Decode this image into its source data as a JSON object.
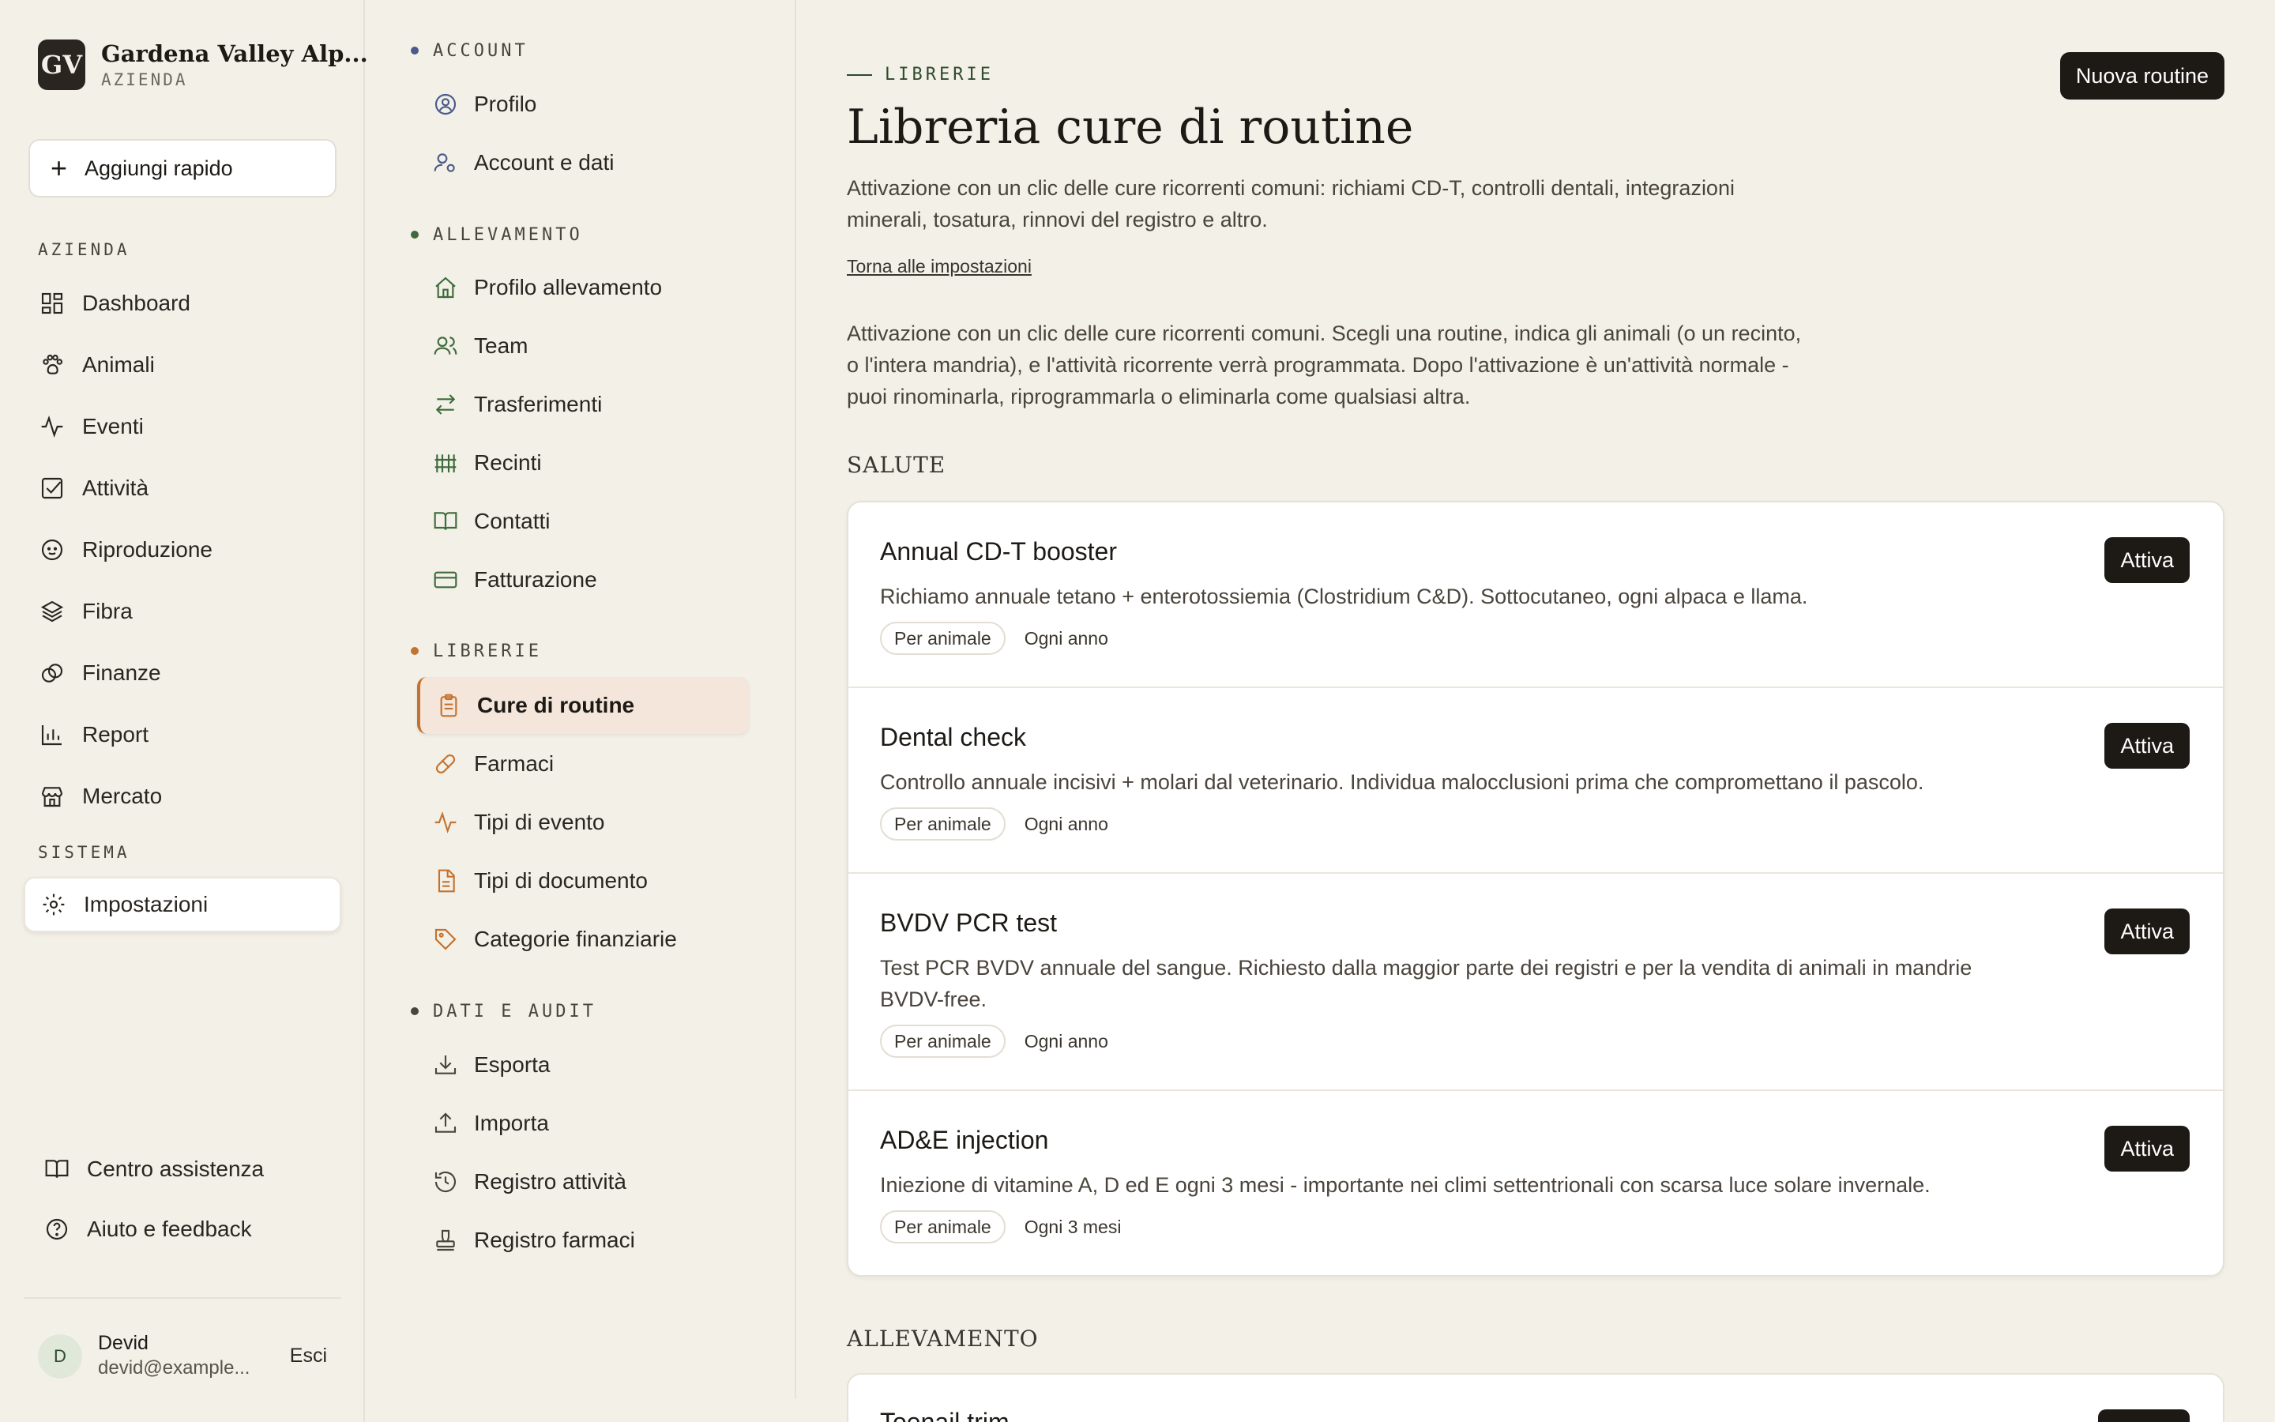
{
  "brand": {
    "logo": "GV",
    "name": "Gardena Valley Alp...",
    "subtitle": "AZIENDA"
  },
  "quick_add": {
    "label": "Aggiungi rapido"
  },
  "sidebar": {
    "section_azienda": "AZIENDA",
    "items": [
      {
        "label": "Dashboard",
        "icon": "dashboard-icon"
      },
      {
        "label": "Animali",
        "icon": "paw-icon"
      },
      {
        "label": "Eventi",
        "icon": "activity-icon"
      },
      {
        "label": "Attività",
        "icon": "checkbox-icon"
      },
      {
        "label": "Riproduzione",
        "icon": "baby-icon"
      },
      {
        "label": "Fibra",
        "icon": "layers-icon"
      },
      {
        "label": "Finanze",
        "icon": "coins-icon"
      },
      {
        "label": "Report",
        "icon": "bar-chart-icon"
      },
      {
        "label": "Mercato",
        "icon": "store-icon"
      }
    ],
    "section_sistema": "SISTEMA",
    "settings": {
      "label": "Impostazioni",
      "icon": "gear-icon"
    },
    "help_center": "Centro assistenza",
    "feedback": "Aiuto e feedback",
    "user": {
      "initial": "D",
      "name": "Devid",
      "email": "devid@example...",
      "logout": "Esci"
    }
  },
  "settings_nav": {
    "sections": [
      {
        "title": "ACCOUNT",
        "dot_color": "#4a5a8a",
        "items": [
          "Profilo",
          "Account e dati"
        ]
      },
      {
        "title": "ALLEVAMENTO",
        "dot_color": "#3d6b3a",
        "items": [
          "Profilo allevamento",
          "Team",
          "Trasferimenti",
          "Recinti",
          "Contatti",
          "Fatturazione"
        ]
      },
      {
        "title": "LIBRERIE",
        "dot_color": "#c4722f",
        "items": [
          "Cure di routine",
          "Farmaci",
          "Tipi di evento",
          "Tipi di documento",
          "Categorie finanziarie"
        ]
      },
      {
        "title": "DATI E AUDIT",
        "dot_color": "#4a443c",
        "items": [
          "Esporta",
          "Importa",
          "Registro attività",
          "Registro farmaci"
        ]
      }
    ]
  },
  "main": {
    "eyebrow": "LIBRERIE",
    "title": "Libreria cure di routine",
    "lead": "Attivazione con un clic delle cure ricorrenti comuni: richiami CD-T, controlli dentali, integrazioni minerali, tosatura, rinnovi del registro e altro.",
    "back_link": "Torna alle impostazioni",
    "description": "Attivazione con un clic delle cure ricorrenti comuni. Scegli una routine, indica gli animali (o un recinto, o l'intera mandria), e l'attività ricorrente verrà programmata. Dopo l'attivazione è un'attività normale - puoi rinominarla, riprogrammarla o eliminarla come qualsiasi altra.",
    "new_button": "Nuova routine",
    "activate_label": "Attiva",
    "group_salute": "SALUTE",
    "routines": [
      {
        "title": "Annual CD-T booster",
        "desc": "Richiamo annuale tetano + enterotossiemia (Clostridium C&D). Sottocutaneo, ogni alpaca e llama.",
        "scope": "Per animale",
        "freq": "Ogni anno"
      },
      {
        "title": "Dental check",
        "desc": "Controllo annuale incisivi + molari dal veterinario. Individua malocclusioni prima che compromettano il pascolo.",
        "scope": "Per animale",
        "freq": "Ogni anno"
      },
      {
        "title": "BVDV PCR test",
        "desc": "Test PCR BVDV annuale del sangue. Richiesto dalla maggior parte dei registri e per la vendita di animali in mandrie BVDV-free.",
        "scope": "Per animale",
        "freq": "Ogni anno"
      },
      {
        "title": "AD&E injection",
        "desc": "Iniezione di vitamine A, D ed E ogni 3 mesi - importante nei climi settentrionali con scarsa luce solare invernale.",
        "scope": "Per animale",
        "freq": "Ogni 3 mesi"
      }
    ],
    "group_allevamento": "ALLEVAMENTO",
    "peek_title": "Toenail trim"
  }
}
